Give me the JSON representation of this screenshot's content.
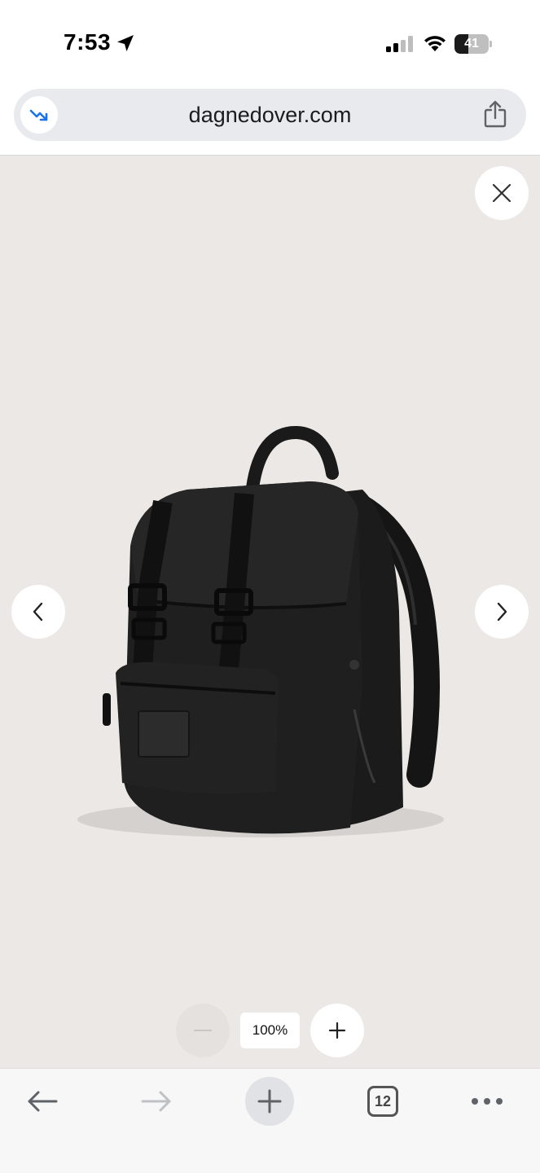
{
  "status_bar": {
    "time": "7:53",
    "battery_level": "41",
    "icons": [
      "location-arrow-icon",
      "cellular-signal-icon",
      "wifi-icon",
      "battery-icon"
    ]
  },
  "address_bar": {
    "url": "dagnedover.com",
    "badge_icon": "trending-down-icon",
    "share_icon": "share-icon"
  },
  "viewer": {
    "close_icon": "close-icon",
    "prev_icon": "chevron-left-icon",
    "next_icon": "chevron-right-icon",
    "image": "black-backpack",
    "zoom": {
      "level": "100%",
      "out_icon": "minus-icon",
      "in_icon": "plus-icon"
    },
    "background_color": "#ece8e6"
  },
  "toolbar": {
    "back_icon": "back-arrow-icon",
    "forward_icon": "forward-arrow-icon",
    "new_tab_icon": "plus-icon",
    "tab_count": "12",
    "more_icon": "more-icon"
  }
}
